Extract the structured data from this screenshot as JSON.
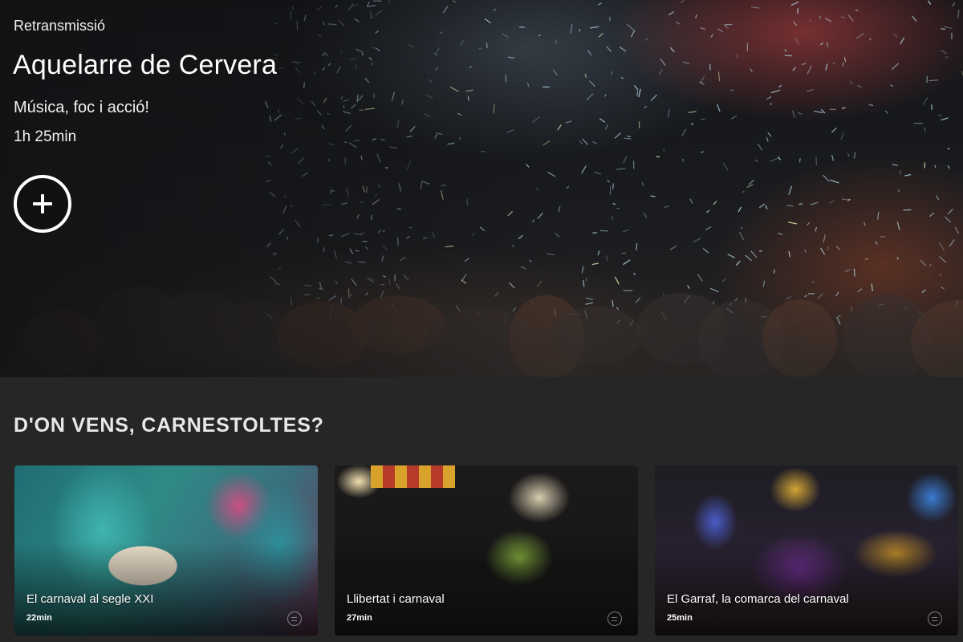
{
  "hero": {
    "eyebrow": "Retransmissió",
    "title": "Aquelarre de Cervera",
    "subtitle": "Música, foc i acció!",
    "duration": "1h 25min",
    "add_icon": "plus-icon"
  },
  "section": {
    "title": "D'ON VENS, CARNESTOLTES?"
  },
  "cards": [
    {
      "title": "El carnaval al segle XXI",
      "duration": "22min"
    },
    {
      "title": "Llibertat i carnaval",
      "duration": "27min"
    },
    {
      "title": "El Garraf, la comarca del carnaval",
      "duration": "25min"
    }
  ]
}
